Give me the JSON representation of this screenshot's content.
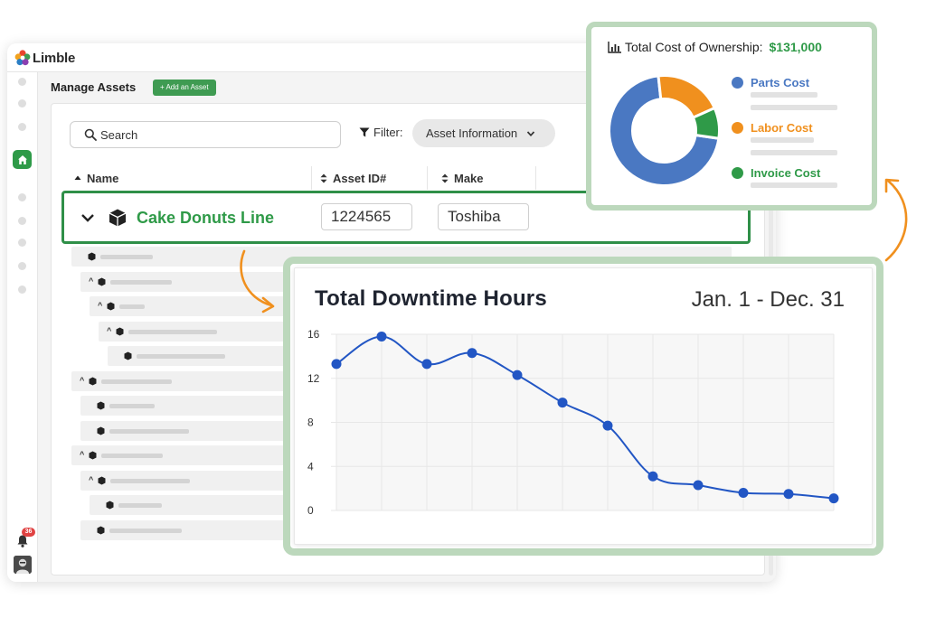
{
  "app": {
    "brand": "Limble",
    "notification_count": "36"
  },
  "page": {
    "title": "Manage Assets",
    "add_button": "+ Add an Asset"
  },
  "toolbar": {
    "search_placeholder": "Search",
    "filter_label": "Filter:",
    "filter_value": "Asset Information"
  },
  "table": {
    "columns": [
      "Name",
      "Asset ID#",
      "Make"
    ],
    "selected_row": {
      "name": "Cake Donuts Line",
      "asset_id": "1224565",
      "make": "Toshiba"
    }
  },
  "tco": {
    "title": "Total Cost of Ownership:",
    "value": "$131,000",
    "legend": [
      {
        "name": "Parts Cost",
        "color": "#4a78c2"
      },
      {
        "name": "Labor Cost",
        "color": "#f0901e"
      },
      {
        "name": "Invoice Cost",
        "color": "#2f9a48"
      }
    ],
    "chart_data": {
      "type": "pie",
      "donut": true,
      "slices": [
        {
          "label": "Parts Cost",
          "value": 71,
          "color": "#4a78c2"
        },
        {
          "label": "Labor Cost",
          "value": 20,
          "color": "#f0901e"
        },
        {
          "label": "Invoice Cost",
          "value": 9,
          "color": "#2f9a48"
        }
      ]
    }
  },
  "downtime": {
    "title": "Total Downtime Hours",
    "range": "Jan. 1 - Dec. 31",
    "chart_data": {
      "type": "line",
      "title": "Total Downtime Hours",
      "x": [
        1,
        2,
        3,
        4,
        5,
        6,
        7,
        8,
        9,
        10,
        11,
        12
      ],
      "values": [
        13.3,
        15.8,
        13.3,
        14.3,
        12.3,
        9.8,
        7.7,
        3.1,
        2.3,
        1.6,
        1.5,
        1.1
      ],
      "ylim": [
        0,
        16
      ],
      "yticks": [
        "0",
        "4",
        "8",
        "12",
        "16"
      ],
      "grid": true,
      "line_color": "#2256c4"
    }
  }
}
